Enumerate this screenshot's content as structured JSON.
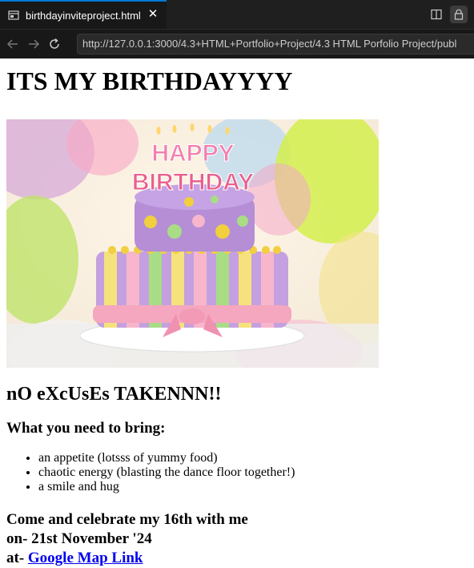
{
  "browser": {
    "tab_title": "birthdayinviteproject.html",
    "url": "http://127.0.0.1:3000/4.3+HTML+Portfolio+Project/4.3 HTML Porfolio Project/publ"
  },
  "page": {
    "heading": "ITS MY BIRTHDAYYYY",
    "cake_topper_top": "HAPPY",
    "cake_topper_bottom": "BIRTHDAY",
    "subheading": "nO eXcUsEs TAKENNN!!",
    "bring_heading": "What you need to bring:",
    "bring_items": [
      "an appetite (lotsss of yummy food)",
      "chaotic energy (blasting the dance floor together!)",
      "a smile and hug"
    ],
    "celebrate_line": "Come and celebrate my 16th with me",
    "date_line": "on- 21st November '24",
    "location_prefix": "at- ",
    "map_link_text": "Google Map Link"
  },
  "colors": {
    "chrome_bg": "#1f1f1f",
    "tab_accent": "#0078d4",
    "link": "#0000ee"
  },
  "icons": {
    "tab": "browser-page-icon",
    "close": "close-icon",
    "split": "split-editor-icon",
    "lock": "lock-icon",
    "back": "back-arrow-icon",
    "forward": "forward-arrow-icon",
    "reload": "reload-icon"
  }
}
